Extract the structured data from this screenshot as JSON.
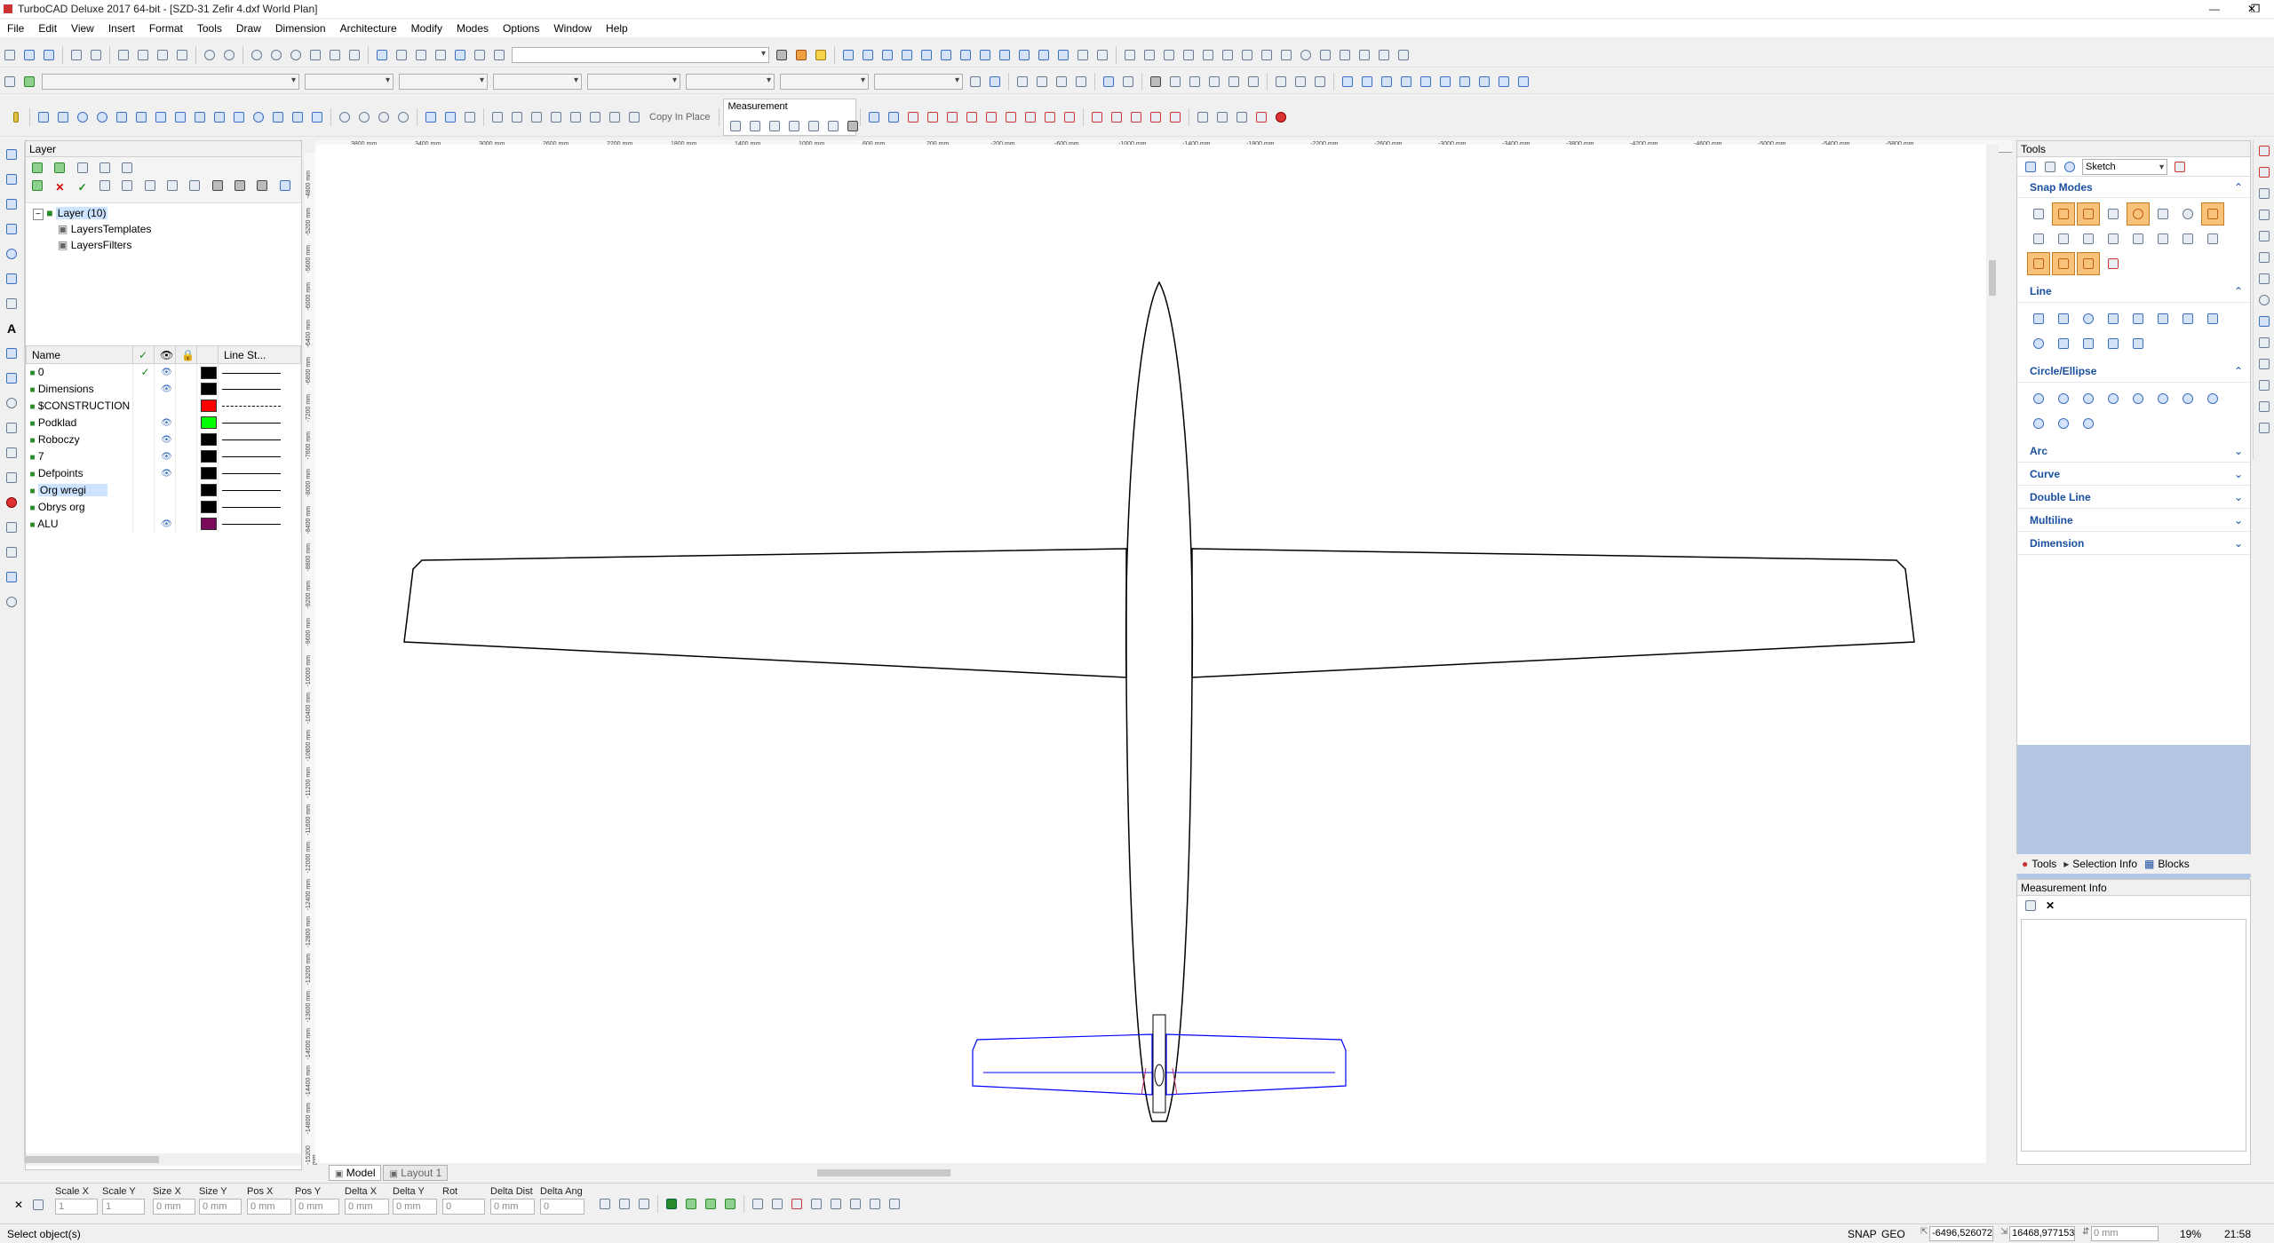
{
  "window": {
    "title": "TurboCAD Deluxe 2017 64-bit - [SZD-31 Zefir 4.dxf World Plan]",
    "controls": [
      "—",
      "❐",
      "✕"
    ]
  },
  "menu": [
    "File",
    "Edit",
    "View",
    "Insert",
    "Format",
    "Tools",
    "Draw",
    "Dimension",
    "Architecture",
    "Modify",
    "Modes",
    "Options",
    "Window",
    "Help"
  ],
  "toolbar": {
    "copy_in_place_label": "Copy In Place",
    "measurement_label": "Measurement"
  },
  "layer_panel": {
    "title": "Layer",
    "tree": [
      "Layer (10)",
      "LayersTemplates",
      "LayersFilters"
    ],
    "columns": [
      "Name",
      "✓",
      "👁",
      "🔒",
      "",
      "Line St..."
    ],
    "rows": [
      {
        "name": "0",
        "active": "✓",
        "visible": "👁",
        "color": "#000000",
        "line": "solid"
      },
      {
        "name": "Dimensions",
        "active": "",
        "visible": "👁",
        "color": "#000000",
        "line": "solid"
      },
      {
        "name": "$CONSTRUCTION",
        "active": "",
        "visible": "",
        "color": "#ff0000",
        "line": "dash"
      },
      {
        "name": "Podklad",
        "active": "",
        "visible": "👁",
        "color": "#00ff00",
        "line": "solid"
      },
      {
        "name": "Roboczy",
        "active": "",
        "visible": "👁",
        "color": "#000000",
        "line": "solid"
      },
      {
        "name": "7",
        "active": "",
        "visible": "👁",
        "color": "#000000",
        "line": "solid"
      },
      {
        "name": "Defpoints",
        "active": "",
        "visible": "👁",
        "color": "#000000",
        "line": "solid"
      },
      {
        "name": "Org wregi",
        "active": "",
        "visible": "",
        "color": "#000000",
        "line": "solid"
      },
      {
        "name": "Obrys org",
        "active": "",
        "visible": "",
        "color": "#000000",
        "line": "solid"
      },
      {
        "name": "ALU",
        "active": "",
        "visible": "👁",
        "color": "#7a0a5a",
        "line": "solid"
      }
    ]
  },
  "ruler_h": [
    "3800 mm",
    "3400 mm",
    "3000 mm",
    "2600 mm",
    "2200 mm",
    "1800 mm",
    "1400 mm",
    "1000 mm",
    "600 mm",
    "200 mm",
    "-200 mm",
    "-600 mm",
    "-1000 mm",
    "-1400 mm",
    "-1800 mm",
    "-2200 mm",
    "-2600 mm",
    "-3000 mm",
    "-3400 mm",
    "-3800 mm",
    "-4200 mm",
    "-4600 mm",
    "-5000 mm",
    "-5400 mm",
    "-5800 mm"
  ],
  "ruler_v": [
    "-4800 mm",
    "-5200 mm",
    "-5600 mm",
    "-6000 mm",
    "-6400 mm",
    "-6800 mm",
    "-7200 mm",
    "-7600 mm",
    "-8000 mm",
    "-8400 mm",
    "-8800 mm",
    "-9200 mm",
    "-9600 mm",
    "-10000 mm",
    "-10400 mm",
    "-10800 mm",
    "-11200 mm",
    "-11600 mm",
    "-12000 mm",
    "-12400 mm",
    "-12800 mm",
    "-13200 mm",
    "-13600 mm",
    "-14000 mm",
    "-14400 mm",
    "-14800 mm",
    "-15200 mm"
  ],
  "tabs": {
    "model": "Model",
    "layout": "Layout 1"
  },
  "tools_panel": {
    "title": "Tools",
    "mode": "Sketch",
    "sections": {
      "snap": "Snap Modes",
      "line": "Line",
      "circle": "Circle/Ellipse",
      "arc": "Arc",
      "curve": "Curve",
      "double_line": "Double Line",
      "multiline": "Multiline",
      "dimension": "Dimension"
    },
    "bottom_tabs": [
      "Tools",
      "Selection Info",
      "Blocks"
    ]
  },
  "measurement_panel": {
    "title": "Measurement Info"
  },
  "inspector": {
    "labels": [
      "Scale X",
      "Scale Y",
      "Size X",
      "Size Y",
      "Pos X",
      "Pos Y",
      "Delta X",
      "Delta Y",
      "Rot",
      "Delta Dist",
      "Delta Ang"
    ],
    "values": [
      "1",
      "1",
      "0 mm",
      "0 mm",
      "0 mm",
      "0 mm",
      "0 mm",
      "0 mm",
      "0",
      "0 mm",
      "0"
    ]
  },
  "status": {
    "message": "Select object(s)",
    "snap": "SNAP",
    "geo": "GEO",
    "x": "-6496,526072",
    "y": "16468,977153",
    "z": "0 mm",
    "zoom": "19%",
    "time": "21:58"
  },
  "colors": {
    "accent": "#1a4fa0",
    "tail": "#0000ff",
    "snap_active": "#f8c27a"
  }
}
